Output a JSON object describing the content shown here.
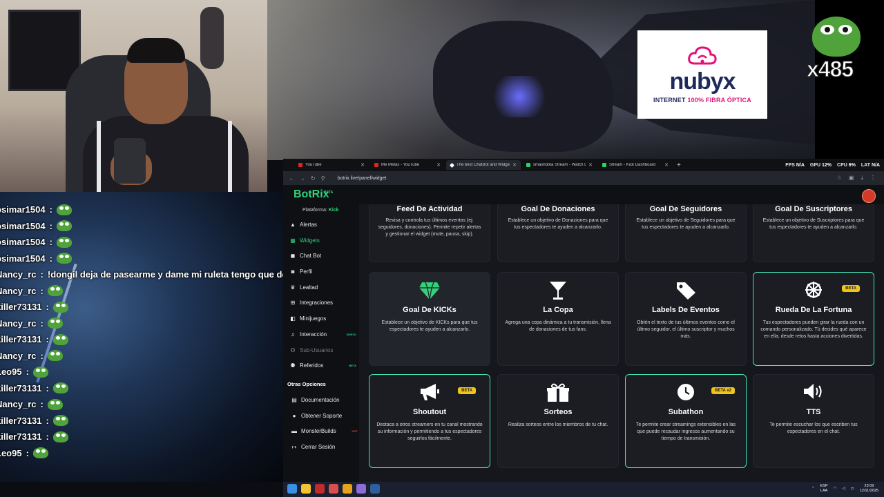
{
  "overlay": {
    "sponsor_word": "nubyx",
    "sponsor_tagline_a": "INTERNET ",
    "sponsor_tagline_b": "100% FIBRA ÓPTICA",
    "emote_count": "x485"
  },
  "chat": [
    {
      "user": "osimar1504",
      "msg": ""
    },
    {
      "user": "osimar1504",
      "msg": ""
    },
    {
      "user": "osimar1504",
      "msg": ""
    },
    {
      "user": "osimar1504",
      "msg": ""
    },
    {
      "user": "Nancy_rc",
      "msg": "!dongil deja de pasearme y dame mi ruleta tengo que dormir"
    },
    {
      "user": "Nancy_rc",
      "msg": ""
    },
    {
      "user": "killer73131",
      "msg": ""
    },
    {
      "user": "Nancy_rc",
      "msg": ""
    },
    {
      "user": "killer73131",
      "msg": ""
    },
    {
      "user": "Nancy_rc",
      "msg": ""
    },
    {
      "user": "Leo95",
      "msg": ""
    },
    {
      "user": "killer73131",
      "msg": ""
    },
    {
      "user": "Nancy_rc",
      "msg": ""
    },
    {
      "user": "killer73131",
      "msg": ""
    },
    {
      "user": "killer73131",
      "msg": ""
    },
    {
      "user": "Leo95",
      "msg": ""
    }
  ],
  "browser": {
    "tabs": [
      {
        "label": "YouTube",
        "icon": "youtube-icon"
      },
      {
        "label": "Me Metas - YouTube",
        "icon": "youtube-icon"
      },
      {
        "label": "The best ChatBot and Widgets",
        "icon": "botrix-icon"
      },
      {
        "label": "smashdota Stream - Watch Live",
        "icon": "kick-icon"
      },
      {
        "label": "Stream - Kick Dashboard",
        "icon": "kick-icon"
      }
    ],
    "url": "botrix.live/panel/widget",
    "stats": {
      "fps_label": "FPS",
      "fps": "N/A",
      "gpu_label": "GPU",
      "gpu": "12%",
      "cpu_label": "CPU",
      "cpu": "6%",
      "lat_label": "LAT",
      "lat": "N/A"
    }
  },
  "app": {
    "logo": "BotRix",
    "logo_badge": "BETA",
    "platform_label": "Plataforma: ",
    "platform_value": "Kick",
    "sidebar": [
      {
        "label": "Alertas",
        "icon": "warning-icon"
      },
      {
        "label": "Widgets",
        "icon": "widgets-icon"
      },
      {
        "label": "Chat Bot",
        "icon": "chat-icon"
      },
      {
        "label": "Perfil",
        "icon": "profile-icon"
      },
      {
        "label": "Lealtad",
        "icon": "trophy-icon"
      },
      {
        "label": "Integraciones",
        "icon": "integrations-icon"
      },
      {
        "label": "Minijuegos",
        "icon": "gamepad-icon"
      },
      {
        "label": "Interacción",
        "icon": "music-icon",
        "badge": "NUEVO"
      },
      {
        "label": "Sub-Usuarios",
        "icon": "users-icon"
      },
      {
        "label": "Referidos",
        "icon": "referral-icon",
        "badge": "BETA"
      }
    ],
    "other_section": "Otras Opciones",
    "other": [
      {
        "label": "Documentación",
        "icon": "docs-icon"
      },
      {
        "label": "Obtener Soporte",
        "icon": "support-icon"
      },
      {
        "label": "MonsterBuilds",
        "icon": "monster-icon",
        "badge": "HOT"
      },
      {
        "label": "Cerrar Sesión",
        "icon": "logout-icon"
      }
    ],
    "cards": [
      {
        "title": "Feed De Actividad",
        "desc": "Revisa y controla tus últimos eventos (ej: seguidores, donaciones). Permite repetir alertas y gestionar el widget (mute, pausa, skip).",
        "icon": ""
      },
      {
        "title": "Goal De Donaciones",
        "desc": "Establece un objetivo de Donaciones para que tus espectadores te ayuden a alcanzarlo.",
        "icon": ""
      },
      {
        "title": "Goal De Seguidores",
        "desc": "Establece un objetivo de Seguidores para que tus espectadores te ayuden a alcanzarlo.",
        "icon": ""
      },
      {
        "title": "Goal De Suscriptores",
        "desc": "Establece un objetivo de Suscriptores para que tus espectadores te ayuden a alcanzarlo.",
        "icon": ""
      },
      {
        "title": "Goal De KICKs",
        "desc": "Establece un objetivo de KICKs para que tus espectadores te ayuden a alcanzarlo.",
        "icon": "diamond-icon"
      },
      {
        "title": "La Copa",
        "desc": "Agrega una copa dinámica a tu transmisión, llena de donaciones de tus fans.",
        "icon": "cup-icon"
      },
      {
        "title": "Labels De Eventos",
        "desc": "Obtén el texto de tus últimos eventos como el último seguidor, el último suscriptor y muchos más.",
        "icon": "tag-icon"
      },
      {
        "title": "Rueda De La Fortuna",
        "desc": "Tus espectadores pueden girar la rueda con un comando personalizado. Tú decides qué aparece en ella, desde retos hasta acciones divertidas.",
        "icon": "wheel-icon",
        "badge": "BETA"
      },
      {
        "title": "Shoutout",
        "desc": "Destaca a otros streamers en tu canal mostrando su información y permitiendo a tus espectadores seguirlos fácilmente.",
        "icon": "megaphone-icon",
        "badge": "BETA"
      },
      {
        "title": "Sorteos",
        "desc": "Realiza sorteos entre los miembros de tu chat.",
        "icon": "gift-icon"
      },
      {
        "title": "Subathon",
        "desc": "Te permite crear streamings extensibles en las que puede recaudar ingresos aumentando su tiempo de transmisión.",
        "icon": "clock-icon",
        "badge": "BETA v2"
      },
      {
        "title": "TTS",
        "desc": "Te permite escuchar los que escriben tus espectadores en el chat.",
        "icon": "speaker-icon"
      }
    ]
  },
  "taskbar": {
    "lang_a": "ESP",
    "lang_b": "LAA",
    "time": "23:09",
    "date": "12/11/2025"
  },
  "colors": {
    "accent": "#33d17a",
    "highlight_border": "#43e6b6",
    "badge": "#f0c419",
    "background": "#121419"
  }
}
